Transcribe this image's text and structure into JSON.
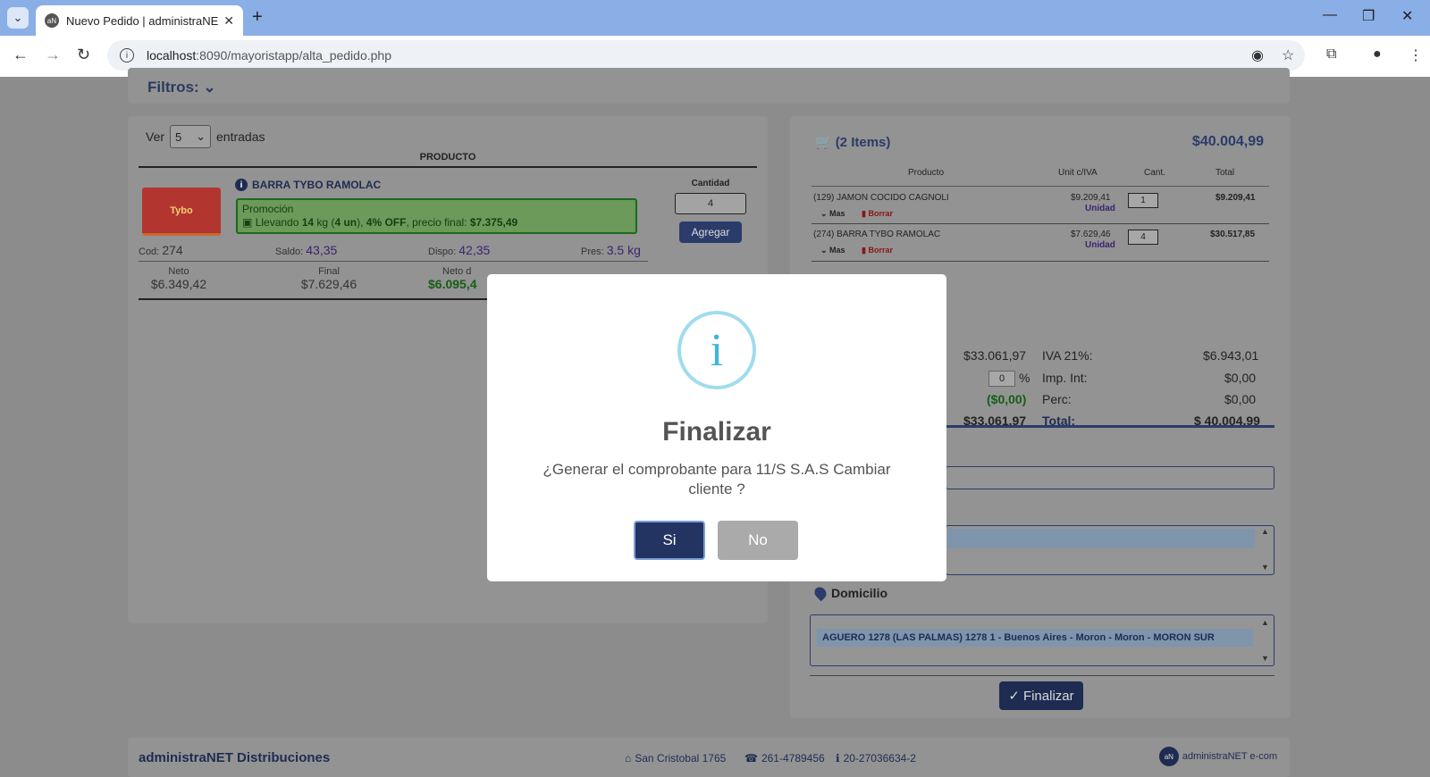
{
  "browser": {
    "tab_title": "Nuevo Pedido | administraNET",
    "url_host": "localhost",
    "url_path": ":8090/mayoristapp/alta_pedido.php"
  },
  "filters": {
    "label": "Filtros:"
  },
  "left": {
    "ver_label": "Ver",
    "entries_value": "5",
    "entries_label": "entradas",
    "column_header": "PRODUCTO",
    "product": {
      "image_text": "Tybo",
      "name": "BARRA TYBO RAMOLAC",
      "promo_title": "Promoción",
      "promo_prefix": "Llevando ",
      "promo_qty": "14",
      "promo_unit_kg": " kg (",
      "promo_un": "4 un",
      "promo_mid": "), ",
      "promo_off": "4% OFF",
      "promo_final_label": ", precio final: ",
      "promo_final": "$7.375,49",
      "cantidad_label": "Cantidad",
      "cantidad_value": "4",
      "agregar": "Agregar",
      "cod_label": "Cod:",
      "cod": "274",
      "saldo_label": "Saldo:",
      "saldo": "43,35",
      "dispo_label": "Dispo:",
      "dispo": "42,35",
      "pres_label": "Pres:",
      "pres": "3.5 kg",
      "neto_label": "Neto",
      "neto": "$6.349,42",
      "final_label": "Final",
      "final": "$7.629,46",
      "netod_label": "Neto d",
      "netod": "$6.095,4"
    }
  },
  "cart": {
    "items_label": "(2 Items)",
    "total": "$40.004,99",
    "headers": {
      "producto": "Producto",
      "unit": "Unit c/IVA",
      "cant": "Cant.",
      "total": "Total"
    },
    "rows": [
      {
        "name": "(129) JAMON COCIDO CAGNOLI",
        "unit_price": "$9.209,41",
        "unit": "Unidad",
        "qty": "1",
        "total": "$9.209,41",
        "mas": "Mas",
        "borrar": "Borrar"
      },
      {
        "name": "(274) BARRA TYBO RAMOLAC",
        "unit_price": "$7.629,46",
        "unit": "Unidad",
        "qty": "4",
        "total": "$30.517,85",
        "mas": "Mas",
        "borrar": "Borrar"
      }
    ],
    "totals": {
      "subtotal": "$33.061,97",
      "iva_label": "IVA 21%:",
      "iva": "$6.943,01",
      "pct_value": "0",
      "pct_sign": "%",
      "impint_label": "Imp. Int:",
      "impint": "$0,00",
      "discount": "($0,00)",
      "perc_label": "Perc:",
      "perc": "$0,00",
      "neto": "$33.061,97",
      "total_label": "Total:",
      "total": "$ 40.004,99"
    },
    "domicilio_label": "Domicilio",
    "domicilio_value": "AGUERO 1278 (LAS PALMAS) 1278 1 - Buenos Aires - Moron - Moron - MORON SUR",
    "finalizar": "Finalizar"
  },
  "footer": {
    "brand": "administraNET Distribuciones",
    "address": "San Cristobal 1765",
    "phone": "261-4789456",
    "cuit": "20-27036634-2",
    "logo_text": "administraNET e-com"
  },
  "modal": {
    "icon": "i",
    "title": "Finalizar",
    "text": "¿Generar el comprobante para 11/S S.A.S Cambiar cliente ?",
    "yes": "Si",
    "no": "No"
  }
}
